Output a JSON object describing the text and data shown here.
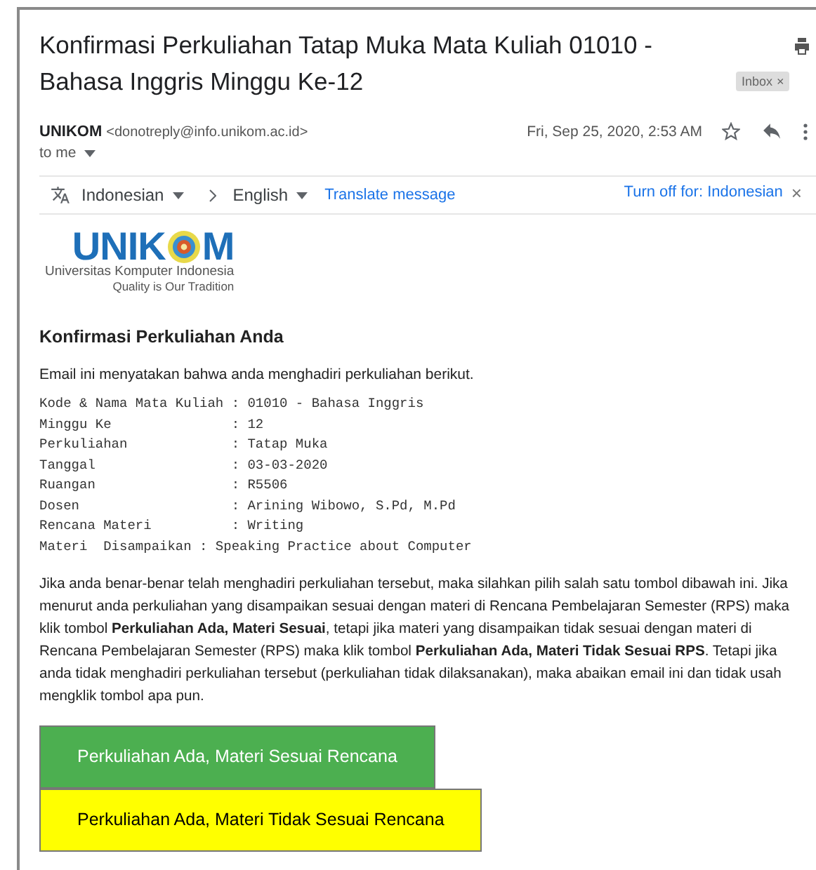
{
  "email": {
    "subject": "Konfirmasi Perkuliahan Tatap Muka Mata Kuliah 01010 - Bahasa Inggris Minggu Ke-12",
    "label": "Inbox",
    "label_close": "×",
    "sender_name": "UNIKOM",
    "sender_address": "<donotreply@info.unikom.ac.id>",
    "date": "Fri, Sep 25, 2020, 2:53 AM",
    "starred": false,
    "recipient": "to me"
  },
  "translate_bar": {
    "from": "Indonesian",
    "to": "English",
    "action": "Translate message",
    "turn_off": "Turn off for: Indonesian",
    "close": "×"
  },
  "body": {
    "logo": {
      "left": "UNIK",
      "right": "M",
      "line1": "Universitas Komputer Indonesia",
      "line2": "Quality is Our Tradition"
    },
    "heading": "Konfirmasi Perkuliahan Anda",
    "intro": "Email ini menyatakan bahwa anda menghadiri perkuliahan berikut.",
    "details": [
      "Kode & Nama Mata Kuliah : 01010 - Bahasa Inggris",
      "Minggu Ke               : 12",
      "Perkuliahan             : Tatap Muka",
      "Tanggal                 : 03-03-2020",
      "Ruangan                 : R5506",
      "Dosen                   : Arining Wibowo, S.Pd, M.Pd",
      "Rencana Materi          : Writing",
      "Materi  Disampaikan : Speaking Practice about Computer"
    ],
    "instructions": "Jika anda benar-benar telah menghadiri perkuliahan tersebut, maka silahkan pilih salah satu tombol dibawah ini. Jika menurut anda perkuliahan yang disampaikan sesuai dengan materi di Rencana Pembelajaran Semester (RPS) maka klik tombol **Perkuliahan Ada, Materi Sesuai**, tetapi jika materi yang disampaikan tidak sesuai dengan materi di Rencana Pembelajaran Semester (RPS) maka klik tombol **Perkuliahan Ada, Materi Tidak Sesuai RPS**. Tetapi jika anda tidak menghadiri perkuliahan tersebut (perkuliahan tidak dilaksanakan), maka abaikan email ini dan tidak usah mengklik tombol apa pun.",
    "buttons": [
      {
        "label": "Perkuliahan Ada, Materi Sesuai Rencana",
        "color": "#4caf50"
      },
      {
        "label": "Perkuliahan Ada, Materi Tidak Sesuai Rencana",
        "color": "#ffff00"
      }
    ]
  }
}
